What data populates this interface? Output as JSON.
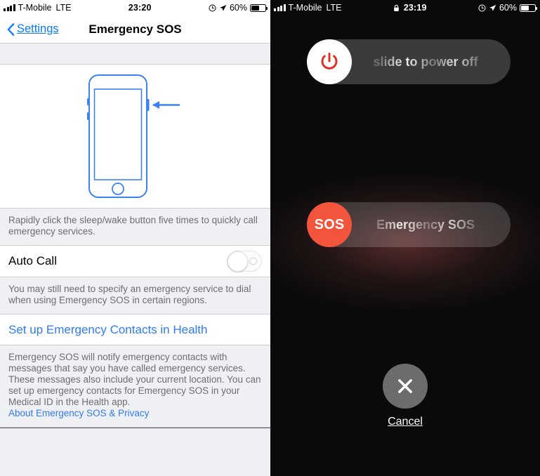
{
  "left_panel": {
    "status_bar": {
      "signal_icon": "signal-bars-icon",
      "carrier": "T-Mobile",
      "network": "LTE",
      "time": "23:20",
      "alarm_icon": "alarm-clock-icon",
      "location_icon": "location-arrow-icon",
      "battery_percent": "60%",
      "battery_icon": "battery-icon",
      "battery_level": 60
    },
    "nav": {
      "back_icon": "chevron-left-icon",
      "back_label": "Settings",
      "title": "Emergency SOS"
    },
    "illustration": {
      "name": "iphone-sleep-wake-button-diagram",
      "accent_color": "#3b82f6"
    },
    "footnote_1": "Rapidly click the sleep/wake button five times to quickly call emergency services.",
    "auto_call": {
      "label": "Auto Call",
      "toggle_state": "off"
    },
    "footnote_2": "You may still need to specify an emergency service to dial when using Emergency SOS in certain regions.",
    "health_link": "Set up Emergency Contacts in Health",
    "footnote_3": "Emergency SOS will notify emergency contacts with messages that say you have called emergency services. These messages also include your current location. You can set up emergency contacts for Emergency SOS in your Medical ID in the Health app.",
    "privacy_link": "About Emergency SOS & Privacy",
    "link_color": "#2f7bf6"
  },
  "right_panel": {
    "status_bar": {
      "signal_icon": "signal-bars-icon",
      "carrier": "T-Mobile",
      "network": "LTE",
      "lock_icon": "lock-icon",
      "time": "23:19",
      "alarm_icon": "alarm-clock-icon",
      "location_icon": "location-arrow-icon",
      "battery_percent": "60%",
      "battery_icon": "battery-icon",
      "battery_level": 60
    },
    "power_slider": {
      "icon": "power-icon",
      "label": "slide to power off",
      "icon_color": "#e03024"
    },
    "sos_slider": {
      "icon_label": "SOS",
      "label": "Emergency SOS",
      "knob_color": "#f2543c"
    },
    "cancel": {
      "icon": "close-x-icon",
      "label": "Cancel"
    },
    "background_color": "#0a0a0a"
  }
}
